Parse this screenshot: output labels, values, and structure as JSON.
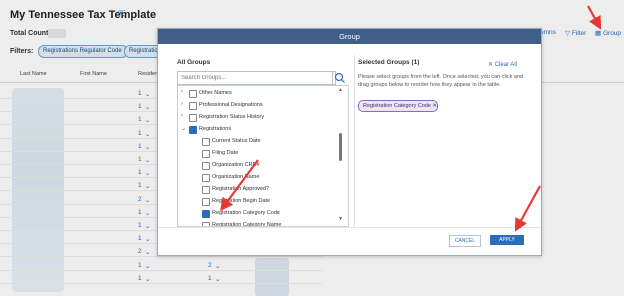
{
  "page": {
    "title": "My Tennessee Tax Template",
    "total_count_label": "Total Count:",
    "filters_label": "Filters:",
    "filter_chips": [
      "Registrations Regulator Code",
      "Registratio"
    ],
    "columns": [
      "Last Name",
      "First Name",
      "Residenti"
    ],
    "toolbar": {
      "columns": "umns",
      "filter": "Filter",
      "group": "Group"
    },
    "row_values": [
      "1",
      "1",
      "1",
      "1",
      "1",
      "1",
      "1",
      "1",
      "2",
      "1",
      "1",
      "1",
      "2",
      "1",
      "1"
    ],
    "row_values_right": [
      "1",
      "2",
      "1"
    ]
  },
  "modal": {
    "title": "Group",
    "all_groups_label": "All Groups",
    "search_placeholder": "Search Groups...",
    "list_items": [
      {
        "label": "Other Names",
        "level": 0,
        "expand": "right",
        "state": "unchecked"
      },
      {
        "label": "Professional Designations",
        "level": 0,
        "expand": "right",
        "state": "unchecked"
      },
      {
        "label": "Registration Status History",
        "level": 0,
        "expand": "right",
        "state": "unchecked"
      },
      {
        "label": "Registrations",
        "level": 0,
        "expand": "down",
        "state": "partial"
      },
      {
        "label": "Current Status Date",
        "level": 1,
        "state": "unchecked"
      },
      {
        "label": "Filing Date",
        "level": 1,
        "state": "unchecked"
      },
      {
        "label": "Organization CRD#",
        "level": 1,
        "state": "unchecked"
      },
      {
        "label": "Organization Name",
        "level": 1,
        "state": "unchecked"
      },
      {
        "label": "Registration Approved?",
        "level": 1,
        "state": "unchecked"
      },
      {
        "label": "Registration Begin Date",
        "level": 1,
        "state": "unchecked"
      },
      {
        "label": "Registration Category Code",
        "level": 1,
        "state": "checked"
      },
      {
        "label": "Registration Category Name",
        "level": 1,
        "state": "unchecked"
      }
    ],
    "selected_groups_label": "Selected Groups (1)",
    "clear_all": "Clear All",
    "instructions": "Please select groups from the left. Once selected, you can click and drag groups below to reorder how they appear in the table.",
    "selected_chip": "Registration Category Code",
    "cancel": "CANCEL",
    "apply": "APPLY"
  },
  "colors": {
    "header_blue": "#3e5f8a",
    "accent_blue": "#2a6ebb",
    "annotation_red": "#e53935",
    "chip_purple": "#8b6bc0"
  }
}
